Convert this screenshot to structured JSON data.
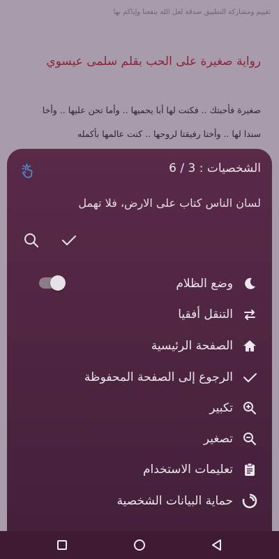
{
  "background": {
    "top_text": "تقييم ومشاركة التطبيق صدقة لعل الله ينفعنا وإياكم بها",
    "title": "رواية صغيرة على الحب بقلم سلمى عيسوي",
    "line1": "صغيرة فأحبتك .. فكنت لها أبا يحميها .. وأما تحن عليها .. وأخا",
    "line2": "سندا لها .. وأختا رفيقتا لروحها .. كنت عالمها بأكمله"
  },
  "sheet": {
    "characters_label": "الشخصيات : 3 / 6",
    "preview_text": "لسان الناس كتاب على الارض، فلا تهمل",
    "icons": {
      "hand": "hand-tap-icon",
      "search": "search-icon",
      "check": "check-icon"
    }
  },
  "menu": {
    "items": [
      {
        "label": "وضع الظلام",
        "icon": "moon-icon",
        "toggle": false
      },
      {
        "label": "التنقل أفقيا",
        "icon": "swap-horizontal-icon"
      },
      {
        "label": "الصفحة الرئيسية",
        "icon": "home-icon"
      },
      {
        "label": "الرجوع إلى الصفحة المحفوظة",
        "icon": "check-icon"
      },
      {
        "label": "تكبير",
        "icon": "zoom-in-icon"
      },
      {
        "label": "تصغير",
        "icon": "zoom-out-icon"
      },
      {
        "label": "تعليمات الاستخدام",
        "icon": "clipboard-icon"
      },
      {
        "label": "حماية البيانات الشخصية",
        "icon": "privacy-icon"
      }
    ]
  },
  "navbar": {
    "icons": [
      "recents-icon",
      "home-nav-icon",
      "back-icon"
    ]
  },
  "colors": {
    "sheet": "#4e2540",
    "title": "#8e2337",
    "navbar": "#3f1a33"
  }
}
